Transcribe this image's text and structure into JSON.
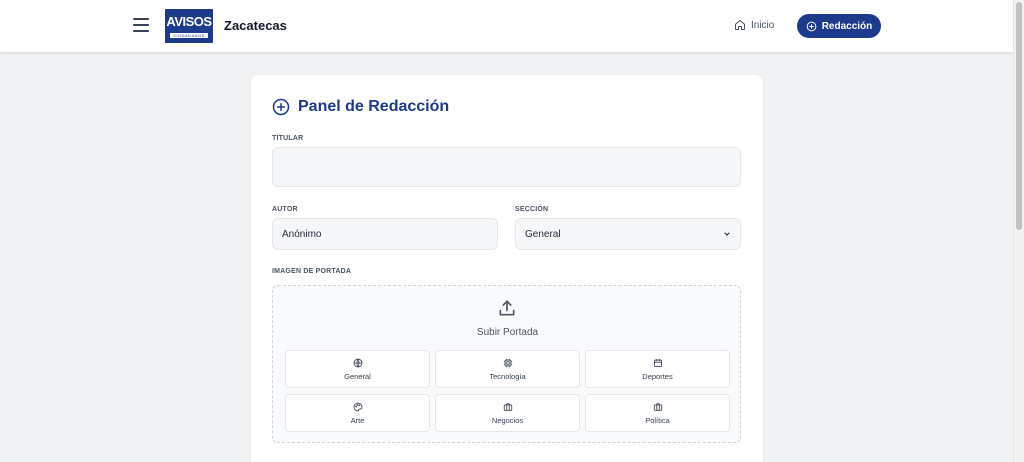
{
  "header": {
    "logo_text": "AVISOS",
    "logo_subtext": "CIUDADANOS",
    "brand": "Zacatecas",
    "nav_home_label": "Inicio",
    "nav_cta_label": "Redacción"
  },
  "panel": {
    "title": "Panel de Redacción",
    "headline_label": "TITULAR",
    "headline_value": "",
    "author_label": "AUTOR",
    "author_value": "Anónimo",
    "section_label": "SECCIÓN",
    "section_value": "General",
    "cover_label": "IMAGEN DE PORTADA",
    "upload_label": "Subir Portada",
    "categories": [
      {
        "label": "General",
        "icon": "globe-icon"
      },
      {
        "label": "Tecnología",
        "icon": "chip-icon"
      },
      {
        "label": "Deportes",
        "icon": "calendar-icon"
      },
      {
        "label": "Arte",
        "icon": "palette-icon"
      },
      {
        "label": "Negocios",
        "icon": "briefcase-icon"
      },
      {
        "label": "Política",
        "icon": "briefcase-icon"
      }
    ]
  },
  "colors": {
    "brand_primary": "#1e3a8a",
    "background": "#f1f2f4",
    "field_bg": "#f6f7f9"
  }
}
